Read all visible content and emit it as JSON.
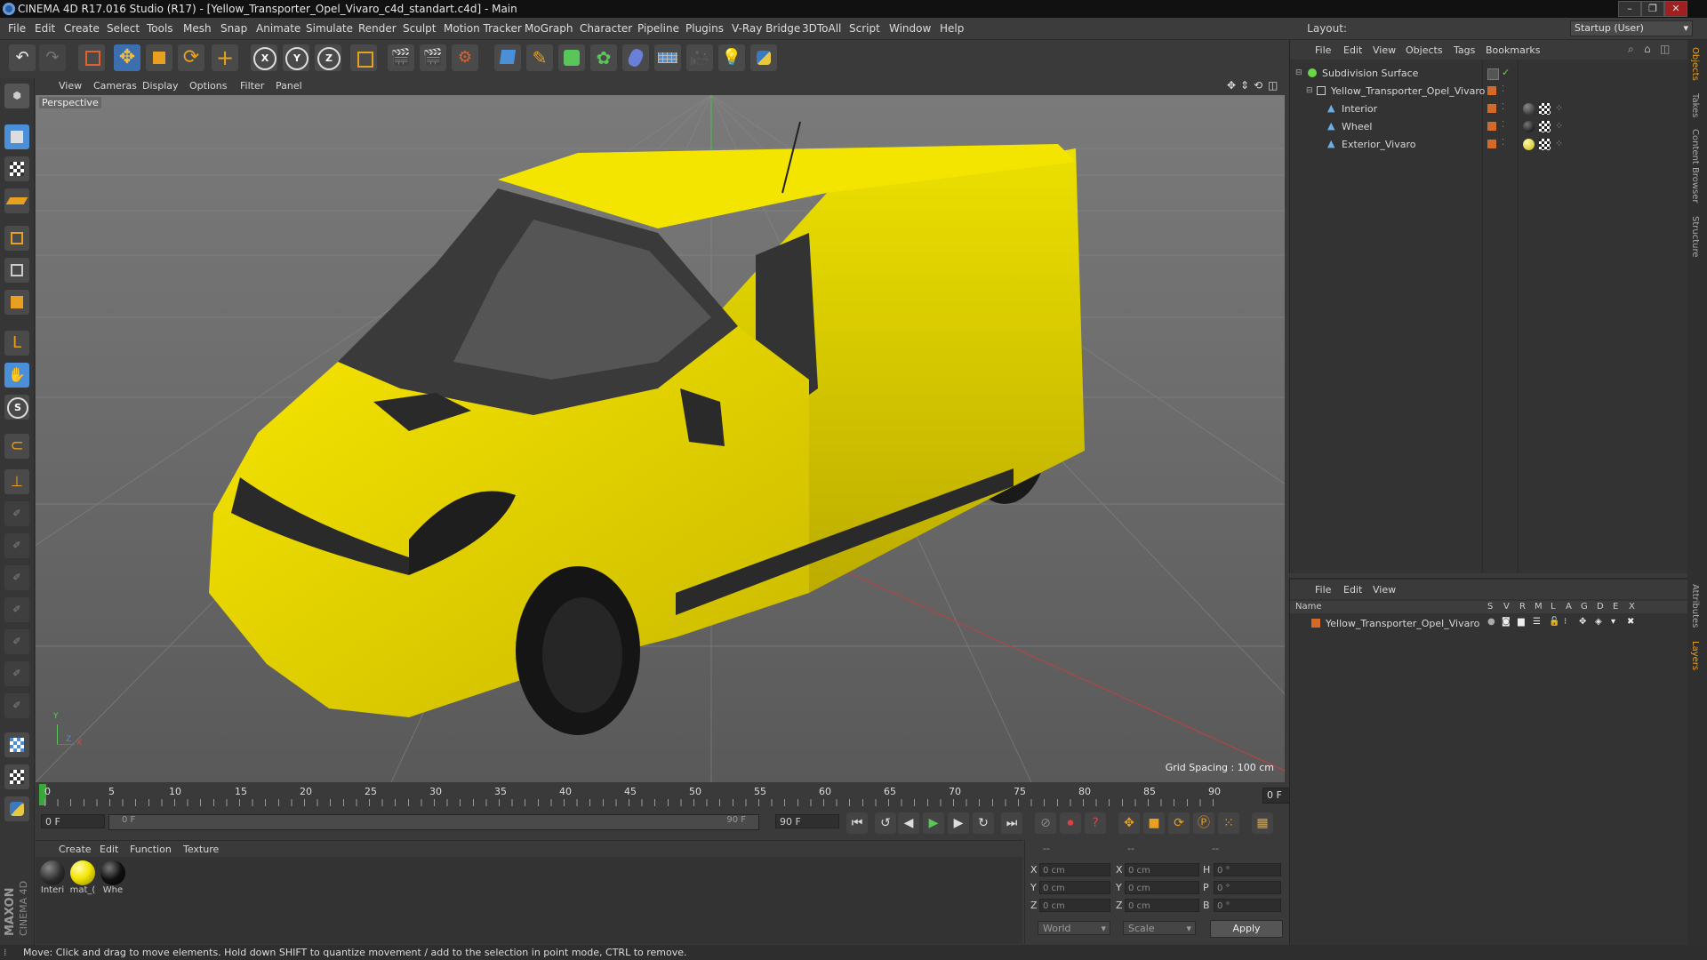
{
  "window": {
    "title": "CINEMA 4D R17.016 Studio (R17) - [Yellow_Transporter_Opel_Vivaro_c4d_standart.c4d] - Main",
    "controls": [
      "–",
      "❐",
      "✕"
    ]
  },
  "menubar": {
    "items": [
      "File",
      "Edit",
      "Create",
      "Select",
      "Tools",
      "Mesh",
      "Snap",
      "Animate",
      "Simulate",
      "Render",
      "Sculpt",
      "Motion Tracker",
      "MoGraph",
      "Character",
      "Pipeline",
      "Plugins",
      "V-Ray Bridge",
      "3DToAll",
      "Script",
      "Window",
      "Help"
    ],
    "layout_label": "Layout:",
    "layout_value": "Startup (User)"
  },
  "viewport": {
    "menu": [
      "View",
      "Cameras",
      "Display",
      "Options",
      "Filter",
      "Panel"
    ],
    "label": "Perspective",
    "grid_spacing": "Grid Spacing : 100 cm",
    "axis": {
      "x": "X",
      "y": "Y",
      "z": "Z"
    }
  },
  "timeline": {
    "ticks": [
      "0",
      "5",
      "10",
      "15",
      "20",
      "25",
      "30",
      "35",
      "40",
      "45",
      "50",
      "55",
      "60",
      "65",
      "70",
      "75",
      "80",
      "85",
      "90"
    ],
    "current_frame": "0 F"
  },
  "transport": {
    "start_field": "0 F",
    "range_start": "0 F",
    "range_end": "90 F",
    "end_field": "90 F"
  },
  "material_manager": {
    "menu": [
      "Create",
      "Edit",
      "Function",
      "Texture"
    ],
    "materials": [
      {
        "label": "Interi",
        "color": "#2a2a2a"
      },
      {
        "label": "mat_(",
        "color": "#f2e600"
      },
      {
        "label": "Whe",
        "color": "#111111"
      }
    ]
  },
  "coordinates": {
    "headers": [
      "--",
      "--",
      "--"
    ],
    "rows": [
      {
        "l1": "X",
        "v1": "0 cm",
        "l2": "X",
        "v2": "0 cm",
        "l3": "H",
        "v3": "0 °"
      },
      {
        "l1": "Y",
        "v1": "0 cm",
        "l2": "Y",
        "v2": "0 cm",
        "l3": "P",
        "v3": "0 °"
      },
      {
        "l1": "Z",
        "v1": "0 cm",
        "l2": "Z",
        "v2": "0 cm",
        "l3": "B",
        "v3": "0 °"
      }
    ],
    "mode": "World",
    "type": "Scale",
    "apply": "Apply"
  },
  "object_manager": {
    "menu": [
      "File",
      "Edit",
      "View",
      "Objects",
      "Tags",
      "Bookmarks"
    ],
    "objects": [
      {
        "name": "Subdivision Surface"
      },
      {
        "name": "Yellow_Transporter_Opel_Vivaro"
      },
      {
        "name": "Interior"
      },
      {
        "name": "Wheel"
      },
      {
        "name": "Exterior_Vivaro"
      }
    ]
  },
  "layer_manager": {
    "menu": [
      "File",
      "Edit",
      "View"
    ],
    "header_name": "Name",
    "header_cols": [
      "S",
      "V",
      "R",
      "M",
      "L",
      "A",
      "G",
      "D",
      "E",
      "X"
    ],
    "layers": [
      {
        "name": "Yellow_Transporter_Opel_Vivaro",
        "color": "#d46a2a"
      }
    ]
  },
  "right_tabs": [
    "Objects",
    "Takes",
    "Content Browser",
    "Structure",
    "Attributes",
    "Layers"
  ],
  "statusbar": {
    "text": "Move: Click and drag to move elements. Hold down SHIFT to quantize movement / add to the selection in point mode, CTRL to remove."
  },
  "brand": {
    "maxon": "MAXON",
    "cinema": "CINEMA 4D"
  },
  "colors": {
    "accent_blue": "#4a8fd8",
    "van_yellow": "#f0e200",
    "object_green": "#6ad64a"
  }
}
